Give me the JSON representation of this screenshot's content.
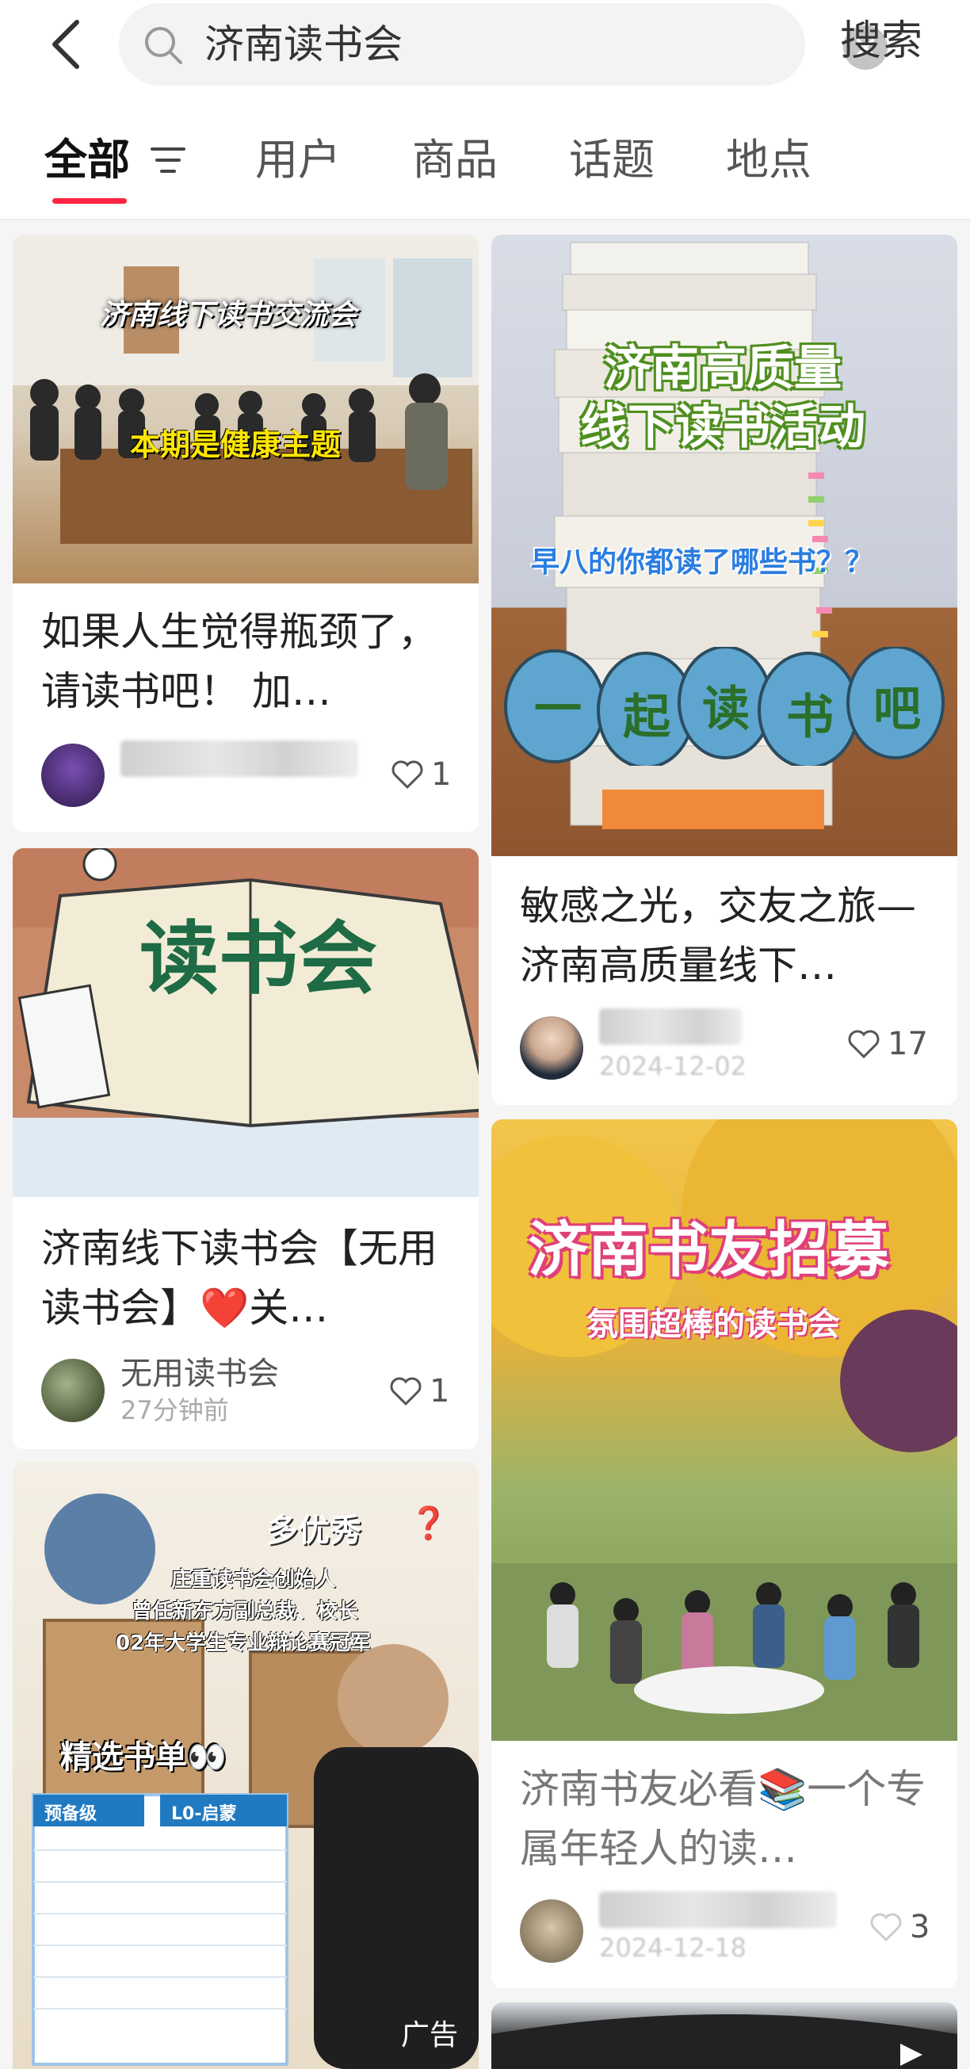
{
  "header": {
    "back_icon": "chevron-left-icon",
    "search_query": "济南读书会",
    "search_button": "搜索"
  },
  "tabs": [
    {
      "label": "全部",
      "active": true
    },
    {
      "label": "用户",
      "active": false
    },
    {
      "label": "商品",
      "active": false
    },
    {
      "label": "话题",
      "active": false
    },
    {
      "label": "地点",
      "active": false
    }
  ],
  "colors": {
    "accent": "#ff2442",
    "like_red": "#ff2442"
  },
  "cards": [
    {
      "id": "card1",
      "image_text": [
        "济南线下读书交流会",
        "本期是健康主题"
      ],
      "title": "如果人生觉得瓶颈了，请读书吧！ 加…",
      "likes": "1"
    },
    {
      "id": "card2",
      "image_text": [
        "济南高质量",
        "线下读书活动",
        "早八的你都读了哪些书？？",
        "一",
        "起",
        "读",
        "书",
        "吧"
      ],
      "title": "敏感之光，交友之旅—济南高质量线下…",
      "date": "2024-12-02",
      "likes": "17"
    },
    {
      "id": "card3",
      "image_text": [
        "读书会"
      ],
      "title": "济南线下读书会【无用读书会】❤️关…",
      "author": "无用读书会",
      "time": "27分钟前",
      "likes": "1"
    },
    {
      "id": "card4",
      "image_text": [
        "济南书友招募",
        "氛围超棒的读书会"
      ],
      "title": "济南书友必看📚一个专属年轻人的读…",
      "date": "2024-12-18",
      "likes": "3"
    },
    {
      "id": "card5",
      "image_text": [
        "多优秀",
        "❓",
        "庄重读书会创始人",
        "曾任新东方副总裁、校长",
        "02年大学生专业辩论赛冠军",
        "精选书单👀",
        "预备级",
        "L0-启蒙"
      ],
      "ad_label": "广告"
    }
  ]
}
